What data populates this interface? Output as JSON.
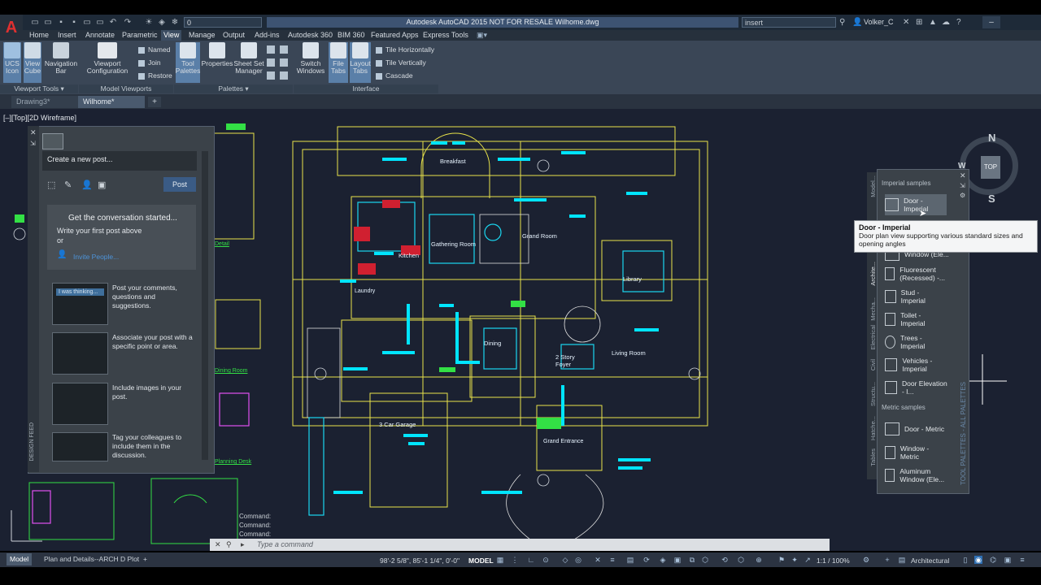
{
  "app": {
    "doc_title": "Autodesk AutoCAD 2015   NOT FOR RESALE    Wilhome.dwg",
    "workspace_value": "0",
    "search_text": "insert",
    "user_name": "Volker_C",
    "logo_letter": "A"
  },
  "ribbon_tabs": [
    "Home",
    "Insert",
    "Annotate",
    "Parametric",
    "View",
    "Manage",
    "Output",
    "Add-ins",
    "Autodesk 360",
    "BIM 360",
    "Featured Apps",
    "Express Tools"
  ],
  "active_ribbon_tab": "View",
  "ribbon": {
    "ucs_icon": "UCS Icon",
    "view_cube": "View Cube",
    "nav_bar": "Navigation Bar",
    "viewport_config": "Viewport Configuration",
    "named": "Named",
    "join": "Join",
    "restore": "Restore",
    "tool_palettes": "Tool Palettes",
    "properties": "Properties",
    "sheet_set_manager": "Sheet Set Manager",
    "switch_windows": "Switch Windows",
    "file_tabs": "File Tabs",
    "layout_tabs": "Layout Tabs",
    "tile_horizontally": "Tile Horizontally",
    "tile_vertically": "Tile Vertically",
    "cascade": "Cascade",
    "panel_viewport_tools": "Viewport Tools ▾",
    "panel_model_viewports": "Model Viewports",
    "panel_palettes": "Palettes ▾",
    "panel_interface": "Interface"
  },
  "file_tabs": [
    "Drawing3*",
    "Wilhome*"
  ],
  "viewport_label": "[–][Top][2D Wireframe]",
  "design_feed": {
    "new_post_placeholder": "Create a new post...",
    "post_button": "Post",
    "conv_title": "Get the conversation started...",
    "conv_line1": "Write your first post above",
    "conv_line2": "or",
    "invite_people": "Invite People...",
    "tip_image_text": "I was thinking...",
    "tips": [
      "Post your comments, questions and suggestions.",
      "Associate your post with a specific point or area.",
      "Include images in your post.",
      "Tag your colleagues to include them in the discussion."
    ],
    "strip_label": "DESIGN FEED"
  },
  "tool_palette": {
    "section_imperial": "Imperial samples",
    "section_metric": "Metric samples",
    "items_imperial": [
      "Door - Imperial",
      "Window (Ele...",
      "Fluorescent (Recessed) -...",
      "Stud - Imperial",
      "Toilet - Imperial",
      "Trees - Imperial",
      "Vehicles - Imperial",
      "Door Elevation - I..."
    ],
    "items_metric": [
      "Door - Metric",
      "Window - Metric",
      "Aluminum Window (Ele..."
    ],
    "tooltip_title": "Door - Imperial",
    "tooltip_desc": "Door plan view supporting various standard sizes and opening angles",
    "side_tabs": [
      "Model...",
      "Archite...",
      "Mecha...",
      "Electrical",
      "Civil",
      "Structu...",
      "Hatche...",
      "Tables"
    ],
    "palette_label": "TOOL PALETTES - ALL PALETTES"
  },
  "nav_cube": {
    "top": "TOP",
    "n": "N",
    "s": "S",
    "w": "W"
  },
  "drawing_labels": [
    "Breakfast",
    "Gathering Room",
    "Grand Room",
    "Kitchen",
    "Library",
    "Laundry",
    "Dining",
    "2 Story Foyer",
    "Living Room",
    "3 Car Garage",
    "Grand Entrance",
    "Detail",
    "Dining Room",
    "Planning Desk"
  ],
  "command": {
    "history": [
      "Command:",
      "Command:",
      "Command:"
    ],
    "placeholder": "Type a command"
  },
  "status_bar": {
    "layout_tabs": [
      "Model",
      "Plan and Details--ARCH D Plot"
    ],
    "coordinates": "98'-2 5/8\", 85'-1 1/4\", 0'-0\"",
    "space": "MODEL",
    "scale": "1:1 / 100%",
    "units": "Architectural"
  }
}
